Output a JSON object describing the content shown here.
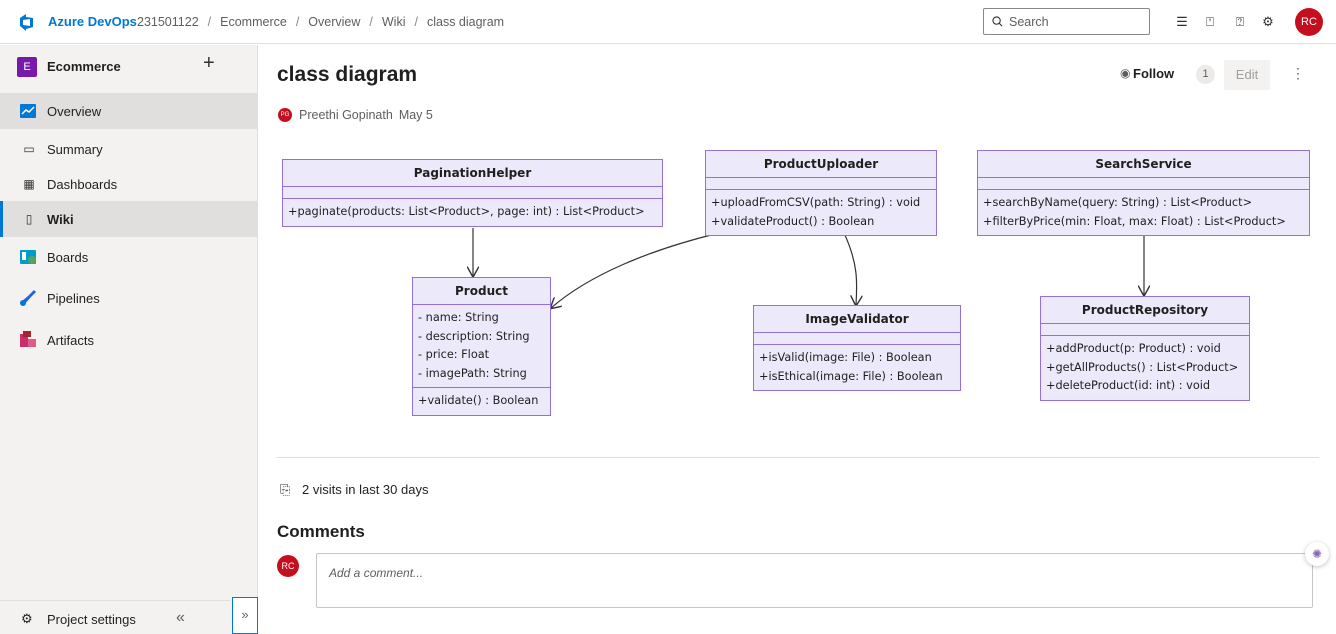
{
  "topbar": {
    "brand": "Azure DevOps",
    "breadcrumbs": [
      "231501122",
      "Ecommerce",
      "Overview",
      "Wiki",
      "class diagram"
    ],
    "search_placeholder": "Search",
    "avatar_initials": "RC"
  },
  "sidebar": {
    "project_initial": "E",
    "project_name": "Ecommerce",
    "items": [
      {
        "label": "Overview",
        "icon": "overview-icon"
      },
      {
        "label": "Summary",
        "icon": "summary-icon"
      },
      {
        "label": "Dashboards",
        "icon": "dashboards-icon"
      },
      {
        "label": "Wiki",
        "icon": "wiki-icon"
      },
      {
        "label": "Boards",
        "icon": "boards-icon"
      },
      {
        "label": "Pipelines",
        "icon": "pipelines-icon"
      },
      {
        "label": "Artifacts",
        "icon": "artifacts-icon"
      }
    ],
    "settings_label": "Project settings"
  },
  "page": {
    "title": "class diagram",
    "follow_label": "Follow",
    "follow_count": "1",
    "edit_label": "Edit",
    "author_initials": "PG",
    "author": "Preethi Gopinath",
    "date": "May 5",
    "visits": "2 visits in last 30 days",
    "comments_heading": "Comments",
    "comment_avatar": "RC",
    "comment_placeholder": "Add a comment..."
  },
  "diagram": {
    "classes": [
      {
        "name": "PaginationHelper",
        "attributes": [],
        "methods": [
          "+paginate(products: List<Product>, page: int) : List<Product>"
        ]
      },
      {
        "name": "ProductUploader",
        "attributes": [],
        "methods": [
          "+uploadFromCSV(path: String) : void",
          "+validateProduct() : Boolean"
        ]
      },
      {
        "name": "SearchService",
        "attributes": [],
        "methods": [
          "+searchByName(query: String) : List<Product>",
          "+filterByPrice(min: Float, max: Float) : List<Product>"
        ]
      },
      {
        "name": "Product",
        "attributes": [
          "- name: String",
          "- description: String",
          "- price: Float",
          "- imagePath: String"
        ],
        "methods": [
          "+validate() : Boolean"
        ]
      },
      {
        "name": "ImageValidator",
        "attributes": [],
        "methods": [
          "+isValid(image: File) : Boolean",
          "+isEthical(image: File) : Boolean"
        ]
      },
      {
        "name": "ProductRepository",
        "attributes": [],
        "methods": [
          "+addProduct(p: Product) : void",
          "+getAllProducts() : List<Product>",
          "+deleteProduct(id: int) : void"
        ]
      }
    ]
  },
  "colors": {
    "accent": "#0078d4",
    "class_fill": "#ece9fa",
    "class_border": "#9370db",
    "avatar": "#c50f1f"
  }
}
